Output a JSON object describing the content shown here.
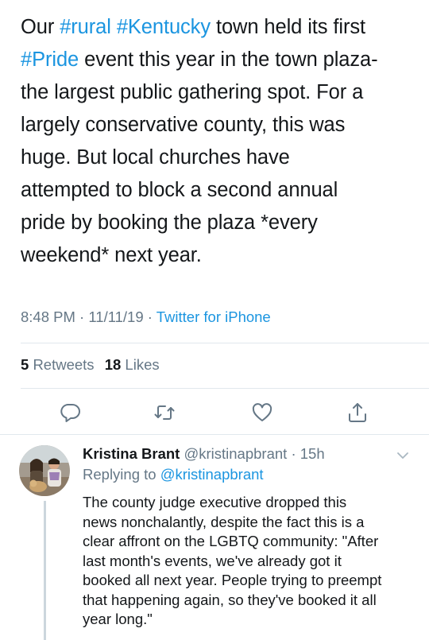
{
  "tweet": {
    "lines": [
      [
        {
          "t": "Our ",
          "tag": false
        },
        {
          "t": "#rural",
          "tag": true
        },
        {
          "t": " ",
          "tag": false
        },
        {
          "t": "#Kentucky",
          "tag": true
        },
        {
          "t": " town held its first",
          "tag": false
        }
      ],
      [
        {
          "t": "#Pride",
          "tag": true
        },
        {
          "t": " event this year in the town plaza-",
          "tag": false
        }
      ],
      [
        {
          "t": "the largest public gathering spot. For a",
          "tag": false
        }
      ],
      [
        {
          "t": "largely conservative county, this was",
          "tag": false
        }
      ],
      [
        {
          "t": "huge. But local churches have",
          "tag": false
        }
      ],
      [
        {
          "t": "attempted to block a second annual",
          "tag": false
        }
      ],
      [
        {
          "t": "pride by booking the plaza *every",
          "tag": false
        }
      ],
      [
        {
          "t": "weekend* next year.",
          "tag": false
        }
      ]
    ],
    "time": "8:48 PM",
    "date": "11/11/19",
    "separator": "·",
    "source": "Twitter for iPhone"
  },
  "stats": {
    "retweets_count": "5",
    "retweets_label": "Retweets",
    "likes_count": "18",
    "likes_label": "Likes"
  },
  "actions": [
    {
      "name": "reply-action",
      "icon": "reply-icon"
    },
    {
      "name": "retweet-action",
      "icon": "retweet-icon"
    },
    {
      "name": "like-action",
      "icon": "heart-icon"
    },
    {
      "name": "share-action",
      "icon": "share-icon"
    }
  ],
  "reply": {
    "name": "Kristina Brant",
    "handle": "@kristinapbrant",
    "separator": "·",
    "age": "15h",
    "replying_prefix": "Replying to",
    "replying_handle": "@kristinapbrant",
    "lines": [
      "The county judge executive dropped this",
      "news nonchalantly, despite the fact this is a",
      "clear affront on the LGBTQ community: \"After",
      "last month's events, we've already got it",
      "booked all next year. People trying to preempt",
      "that happening again, so they've booked it all",
      "year long.\""
    ]
  },
  "colors": {
    "link": "#1b95e0",
    "text": "#14171a",
    "muted": "#657786",
    "divider": "#e1e8ed",
    "thread_line": "#ccd6dd"
  }
}
